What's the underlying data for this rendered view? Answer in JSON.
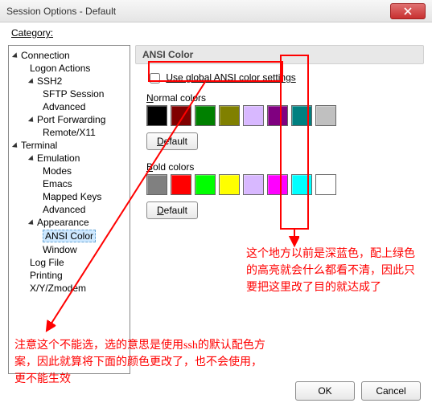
{
  "window": {
    "title": "Session Options - Default"
  },
  "category_label": "Category:",
  "tree": {
    "connection": "Connection",
    "logon": "Logon Actions",
    "ssh2": "SSH2",
    "sftp": "SFTP Session",
    "advanced1": "Advanced",
    "portfwd": "Port Forwarding",
    "remotex11": "Remote/X11",
    "terminal": "Terminal",
    "emulation": "Emulation",
    "modes": "Modes",
    "emacs": "Emacs",
    "mappedkeys": "Mapped Keys",
    "advanced2": "Advanced",
    "appearance": "Appearance",
    "ansicolor": "ANSI Color",
    "window": "Window",
    "logfile": "Log File",
    "printing": "Printing",
    "xyzmodem": "X/Y/Zmodem"
  },
  "panel": {
    "group_title": "ANSI Color",
    "use_global": "Use global ANSI color settings",
    "normal_label_pre": "N",
    "normal_label_rest": "ormal colors",
    "bold_label_pre": "B",
    "bold_label_rest": "old colors",
    "default_btn_pre": "D",
    "default_btn_rest": "efault",
    "normal_colors": [
      "#000000",
      "#800000",
      "#008000",
      "#808000",
      "#d8b8ff",
      "#800080",
      "#008080",
      "#c0c0c0"
    ],
    "bold_colors": [
      "#808080",
      "#ff0000",
      "#00ff00",
      "#ffff00",
      "#d8b8ff",
      "#ff00ff",
      "#00ffff",
      "#ffffff"
    ]
  },
  "footer": {
    "ok": "OK",
    "cancel": "Cancel"
  },
  "annotations": {
    "left": "注意这个不能选，选的意思是使用ssh的默认配色方案，因此就算将下面的颜色更改了，也不会使用，更不能生效",
    "right": "这个地方以前是深蓝色，配上绿色的高亮就会什么都看不清，因此只要把这里改了目的就达成了"
  }
}
